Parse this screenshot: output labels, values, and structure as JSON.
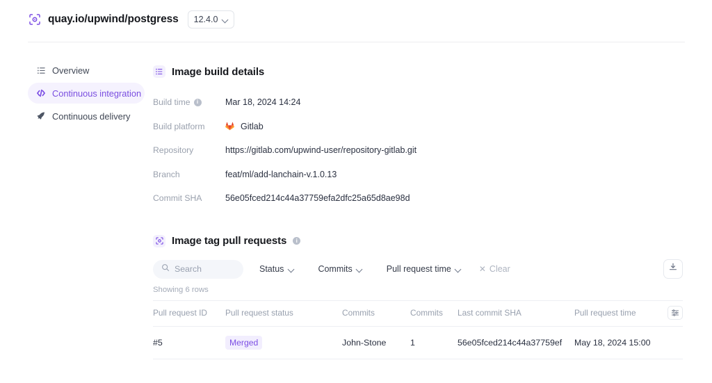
{
  "header": {
    "repo_icon": "container-registry-icon",
    "title": "quay.io/upwind/postgress",
    "version": "12.4.0",
    "version_chevron": "chevron-down-icon"
  },
  "sidebar": {
    "items": [
      {
        "label": "Overview",
        "icon": "list-icon",
        "active": false
      },
      {
        "label": "Continuous integration",
        "icon": "code-brackets-icon",
        "active": true
      },
      {
        "label": "Continuous delivery",
        "icon": "rocket-icon",
        "active": false
      }
    ]
  },
  "build_details": {
    "title": "Image build details",
    "title_icon": "list-icon",
    "rows": [
      {
        "key": "Build time",
        "value": "Mar 18, 2024 14:24",
        "info": true,
        "icon": ""
      },
      {
        "key": "Build platform",
        "value": "Gitlab",
        "info": false,
        "icon": "gitlab-fox-icon"
      },
      {
        "key": "Repository",
        "value": "https://gitlab.com/upwind-user/repository-gitlab.git",
        "info": false,
        "icon": ""
      },
      {
        "key": "Branch",
        "value": "feat/ml/add-lanchain-v.1.0.13",
        "info": false,
        "icon": ""
      },
      {
        "key": "Commit SHA",
        "value": "56e05fced214c44a37759efa2dfc25a65d8ae98d",
        "info": false,
        "icon": ""
      }
    ]
  },
  "pull_requests": {
    "title": "Image tag pull requests",
    "title_icon": "container-registry-icon",
    "title_info_icon": "info-icon",
    "toolbar": {
      "search_placeholder": "Search",
      "search_value": "",
      "search_icon": "search-icon",
      "filters": [
        {
          "label": "Status",
          "icon": "chevron-down-icon"
        },
        {
          "label": "Commits",
          "icon": "chevron-down-icon"
        },
        {
          "label": "Pull request time",
          "icon": "chevron-down-icon"
        }
      ],
      "clear_label": "Clear",
      "clear_icon": "close-icon",
      "export_icon": "download-icon"
    },
    "rows_count_text": "Showing 6 rows",
    "columns": [
      "Pull request ID",
      "Pull request status",
      "Commits",
      "Commits",
      "Last commit SHA",
      "Pull request time"
    ],
    "settings_icon": "table-settings-icon",
    "rows": [
      {
        "id": "#5",
        "status": "Merged",
        "commits_author": "John-Stone",
        "commits_count": "1",
        "last_commit_sha": "56e05fced214c44a37759ef",
        "pr_time": "May 18, 2024 15:00"
      }
    ]
  },
  "colors": {
    "accent": "#7c4ee4",
    "accent_bg": "#f5f2fe",
    "badge_bg": "#f2eefe",
    "muted_text": "#98a0ae",
    "gitlab_orange": "#e24329"
  }
}
